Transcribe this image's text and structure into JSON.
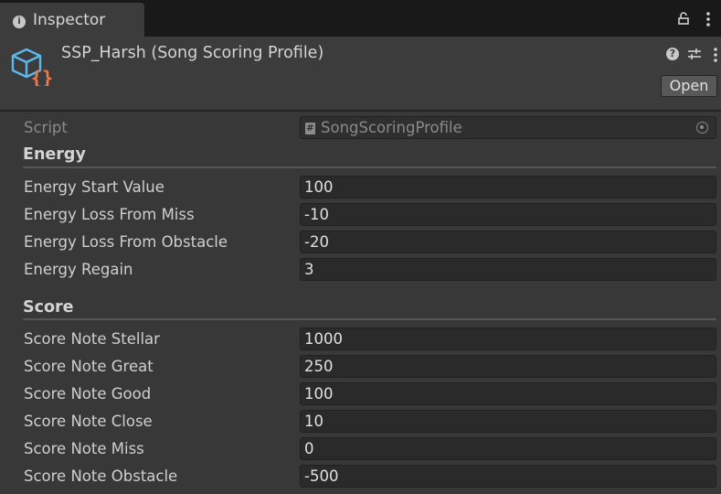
{
  "tab": {
    "label": "Inspector"
  },
  "header": {
    "title": "SSP_Harsh (Song Scoring Profile)",
    "open_label": "Open"
  },
  "script": {
    "label": "Script",
    "value": "SongScoringProfile"
  },
  "energy": {
    "title": "Energy",
    "rows": [
      {
        "label": "Energy Start Value",
        "value": "100"
      },
      {
        "label": "Energy Loss From Miss",
        "value": "-10"
      },
      {
        "label": "Energy Loss From Obstacle",
        "value": "-20"
      },
      {
        "label": "Energy Regain",
        "value": "3"
      }
    ]
  },
  "score": {
    "title": "Score",
    "rows": [
      {
        "label": "Score Note Stellar",
        "value": "1000"
      },
      {
        "label": "Score Note Great",
        "value": "250"
      },
      {
        "label": "Score Note Good",
        "value": "100"
      },
      {
        "label": "Score Note Close",
        "value": "10"
      },
      {
        "label": "Score Note Miss",
        "value": "0"
      },
      {
        "label": "Score Note Obstacle",
        "value": "-500"
      }
    ]
  },
  "icons": [
    "info-icon",
    "lock-icon",
    "menu-icon",
    "asset-icon",
    "help-icon",
    "preset-icon",
    "script-icon",
    "object-picker-icon"
  ]
}
